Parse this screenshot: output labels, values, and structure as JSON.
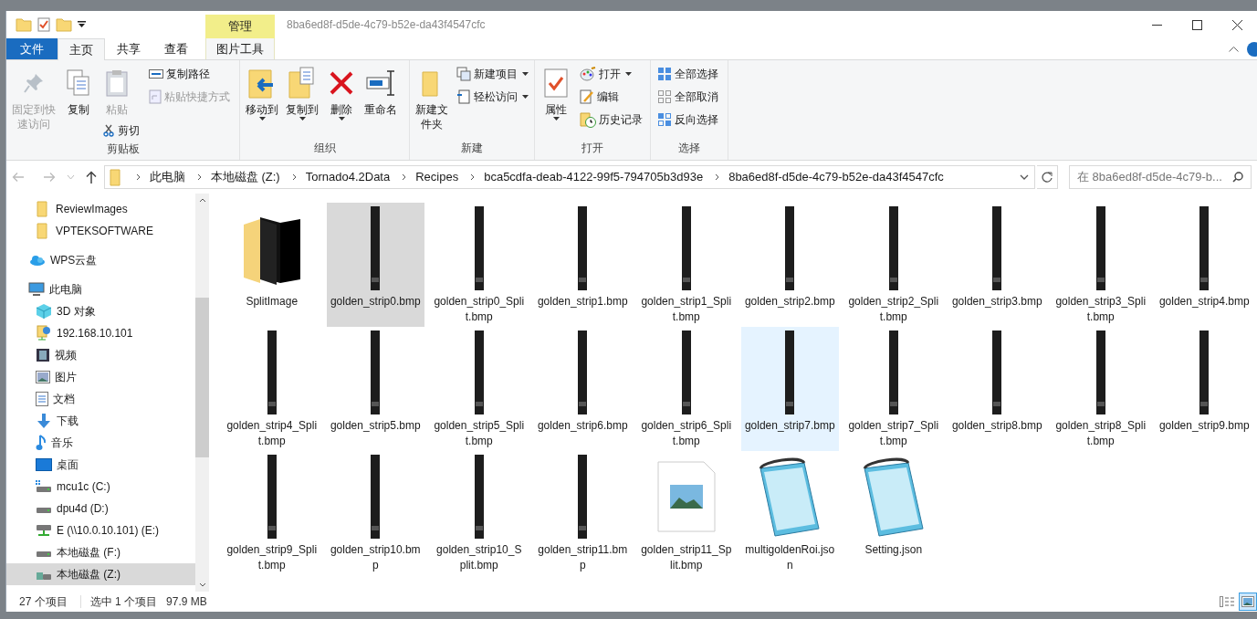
{
  "title_bar": {
    "title": "8ba6ed8f-d5de-4c79-b52e-da43f4547cfc",
    "context_tab": "管理"
  },
  "ribbon_tabs": [
    {
      "label": "文件",
      "kind": "file",
      "selected": false
    },
    {
      "label": "主页",
      "kind": "tab",
      "selected": true
    },
    {
      "label": "共享",
      "kind": "tab",
      "selected": false
    },
    {
      "label": "查看",
      "kind": "tab",
      "selected": false
    },
    {
      "label": "图片工具",
      "kind": "context",
      "selected": false
    }
  ],
  "ribbon_groups": [
    {
      "name": "剪贴板",
      "columns": [
        [
          {
            "label": "固定到快速访问",
            "kind": "large",
            "disabled": true,
            "dropdown": false
          }
        ],
        [
          {
            "label": "复制",
            "kind": "large",
            "disabled": false,
            "dropdown": false
          }
        ],
        [
          {
            "label": "粘贴",
            "kind": "large",
            "disabled": true,
            "dropdown": false
          },
          {
            "label": "剪切",
            "kind": "small",
            "disabled": false,
            "dropdown": false
          }
        ],
        [
          {
            "label": "复制路径",
            "kind": "small",
            "disabled": false,
            "dropdown": false
          },
          {
            "label": "粘贴快捷方式",
            "kind": "small",
            "disabled": true,
            "dropdown": false
          }
        ]
      ]
    },
    {
      "name": "组织",
      "columns": [
        [
          {
            "label": "移动到",
            "kind": "large",
            "disabled": false,
            "dropdown": true
          }
        ],
        [
          {
            "label": "复制到",
            "kind": "large",
            "disabled": false,
            "dropdown": true
          }
        ],
        [
          {
            "label": "删除",
            "kind": "large",
            "disabled": false,
            "dropdown": true
          }
        ],
        [
          {
            "label": "重命名",
            "kind": "large",
            "disabled": false,
            "dropdown": false
          }
        ]
      ]
    },
    {
      "name": "新建",
      "columns": [
        [
          {
            "label": "新建文件夹",
            "kind": "large",
            "disabled": false,
            "dropdown": false
          }
        ],
        [
          {
            "label": "新建项目",
            "kind": "small",
            "disabled": false,
            "dropdown": true
          },
          {
            "label": "轻松访问",
            "kind": "small",
            "disabled": false,
            "dropdown": true
          }
        ]
      ]
    },
    {
      "name": "打开",
      "columns": [
        [
          {
            "label": "属性",
            "kind": "large",
            "disabled": false,
            "dropdown": true
          }
        ],
        [
          {
            "label": "打开",
            "kind": "small",
            "disabled": false,
            "dropdown": true
          },
          {
            "label": "编辑",
            "kind": "small",
            "disabled": false,
            "dropdown": false
          },
          {
            "label": "历史记录",
            "kind": "small",
            "disabled": false,
            "dropdown": false
          }
        ]
      ]
    },
    {
      "name": "选择",
      "columns": [
        [
          {
            "label": "全部选择",
            "kind": "small",
            "disabled": false,
            "dropdown": false
          },
          {
            "label": "全部取消",
            "kind": "small",
            "disabled": false,
            "dropdown": false
          },
          {
            "label": "反向选择",
            "kind": "small",
            "disabled": false,
            "dropdown": false
          }
        ]
      ]
    }
  ],
  "address_bar": {
    "breadcrumbs": [
      "此电脑",
      "本地磁盘 (Z:)",
      "Tornado4.2Data",
      "Recipes",
      "bca5cdfa-deab-4122-99f5-794705b3d93e",
      "8ba6ed8f-d5de-4c79-b52e-da43f4547cfc"
    ]
  },
  "search": {
    "placeholder": "在 8ba6ed8f-d5de-4c79-b..."
  },
  "sidebar": {
    "items": [
      {
        "label": "ReviewImages",
        "selected": false
      },
      {
        "label": "VPTEKSOFTWARE",
        "selected": false
      },
      {
        "label": "WPS云盘",
        "selected": false
      },
      {
        "label": "此电脑",
        "selected": false,
        "children": [
          {
            "label": "3D 对象",
            "selected": false
          },
          {
            "label": "192.168.10.101",
            "selected": false
          },
          {
            "label": "视频",
            "selected": false
          },
          {
            "label": "图片",
            "selected": false
          },
          {
            "label": "文档",
            "selected": false
          },
          {
            "label": "下载",
            "selected": false
          },
          {
            "label": "音乐",
            "selected": false
          },
          {
            "label": "桌面",
            "selected": false
          },
          {
            "label": "mcu1c (C:)",
            "selected": false
          },
          {
            "label": "dpu4d (D:)",
            "selected": false
          },
          {
            "label": "E (\\\\10.0.10.101) (E:)",
            "selected": false
          },
          {
            "label": "本地磁盘 (F:)",
            "selected": false
          },
          {
            "label": "本地磁盘 (Z:)",
            "selected": true
          }
        ]
      }
    ]
  },
  "files": [
    {
      "name": "SplitImage",
      "kind": "folder",
      "selected": false,
      "hovered": false
    },
    {
      "name": "golden_strip0.bmp",
      "kind": "bitmap",
      "selected": true,
      "hovered": false
    },
    {
      "name": "golden_strip0_Split.bmp",
      "kind": "bitmap",
      "selected": false,
      "hovered": false
    },
    {
      "name": "golden_strip1.bmp",
      "kind": "bitmap",
      "selected": false,
      "hovered": false
    },
    {
      "name": "golden_strip1_Split.bmp",
      "kind": "bitmap",
      "selected": false,
      "hovered": false
    },
    {
      "name": "golden_strip2.bmp",
      "kind": "bitmap",
      "selected": false,
      "hovered": false
    },
    {
      "name": "golden_strip2_Split.bmp",
      "kind": "bitmap",
      "selected": false,
      "hovered": false
    },
    {
      "name": "golden_strip3.bmp",
      "kind": "bitmap",
      "selected": false,
      "hovered": false
    },
    {
      "name": "golden_strip3_Split.bmp",
      "kind": "bitmap",
      "selected": false,
      "hovered": false
    },
    {
      "name": "golden_strip4.bmp",
      "kind": "bitmap",
      "selected": false,
      "hovered": false
    },
    {
      "name": "golden_strip4_Split.bmp",
      "kind": "bitmap",
      "selected": false,
      "hovered": false
    },
    {
      "name": "golden_strip5.bmp",
      "kind": "bitmap",
      "selected": false,
      "hovered": false
    },
    {
      "name": "golden_strip5_Split.bmp",
      "kind": "bitmap",
      "selected": false,
      "hovered": false
    },
    {
      "name": "golden_strip6.bmp",
      "kind": "bitmap",
      "selected": false,
      "hovered": false
    },
    {
      "name": "golden_strip6_Split.bmp",
      "kind": "bitmap",
      "selected": false,
      "hovered": false
    },
    {
      "name": "golden_strip7.bmp",
      "kind": "bitmap",
      "selected": false,
      "hovered": true
    },
    {
      "name": "golden_strip7_Split.bmp",
      "kind": "bitmap",
      "selected": false,
      "hovered": false
    },
    {
      "name": "golden_strip8.bmp",
      "kind": "bitmap",
      "selected": false,
      "hovered": false
    },
    {
      "name": "golden_strip8_Split.bmp",
      "kind": "bitmap",
      "selected": false,
      "hovered": false
    },
    {
      "name": "golden_strip9.bmp",
      "kind": "bitmap",
      "selected": false,
      "hovered": false
    },
    {
      "name": "golden_strip9_Split.bmp",
      "kind": "bitmap",
      "selected": false,
      "hovered": false
    },
    {
      "name": "golden_strip10.bmp",
      "kind": "bitmap",
      "selected": false,
      "hovered": false
    },
    {
      "name": "golden_strip10_Split.bmp",
      "kind": "bitmap",
      "selected": false,
      "hovered": false
    },
    {
      "name": "golden_strip11.bmp",
      "kind": "bitmap",
      "selected": false,
      "hovered": false
    },
    {
      "name": "golden_strip11_Split.bmp",
      "kind": "image",
      "selected": false,
      "hovered": false
    },
    {
      "name": "multigoldenRoi.json",
      "kind": "text",
      "selected": false,
      "hovered": false
    },
    {
      "name": "Setting.json",
      "kind": "text",
      "selected": false,
      "hovered": false
    }
  ],
  "status_bar": {
    "item_count": "27 个项目",
    "selection": "选中 1 个项目",
    "size": "97.9 MB",
    "views": [
      {
        "kind": "details",
        "selected": false
      },
      {
        "kind": "large_icons",
        "selected": true
      }
    ]
  }
}
